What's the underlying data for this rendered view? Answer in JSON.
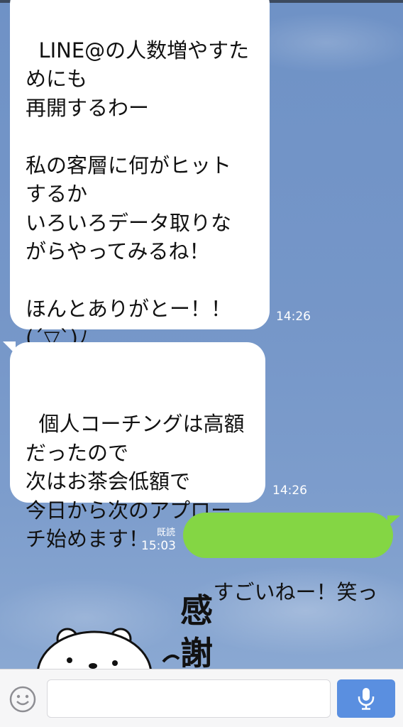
{
  "messages": [
    {
      "side": "left",
      "text": "LINE@の人数増やすた\nめにも\n再開するわー\n\n私の客層に何がヒット\nするか\nいろいろデータ取りな\nがらやってみるね！\n\nほんとありがとー！！\n(´▽`)ﾉ",
      "time": "14:26"
    },
    {
      "side": "left",
      "text": "個人コーチングは高額\nだったので\n次はお茶会低額で\n今日から次のアプロー\nチ始めます！",
      "time": "14:26"
    },
    {
      "side": "right",
      "text": "すごいねー！笑っ",
      "read_label": "既読",
      "time": "15:03"
    }
  ],
  "sticker": {
    "text": "感謝",
    "description": "white bear sticker"
  },
  "input_bar": {
    "placeholder": "",
    "emoji_icon": "smiley-icon",
    "mic_icon": "microphone-icon"
  },
  "colors": {
    "background": "#7596c8",
    "own_bubble": "#84d644",
    "other_bubble": "#ffffff",
    "mic_button": "#5a8fe0"
  }
}
